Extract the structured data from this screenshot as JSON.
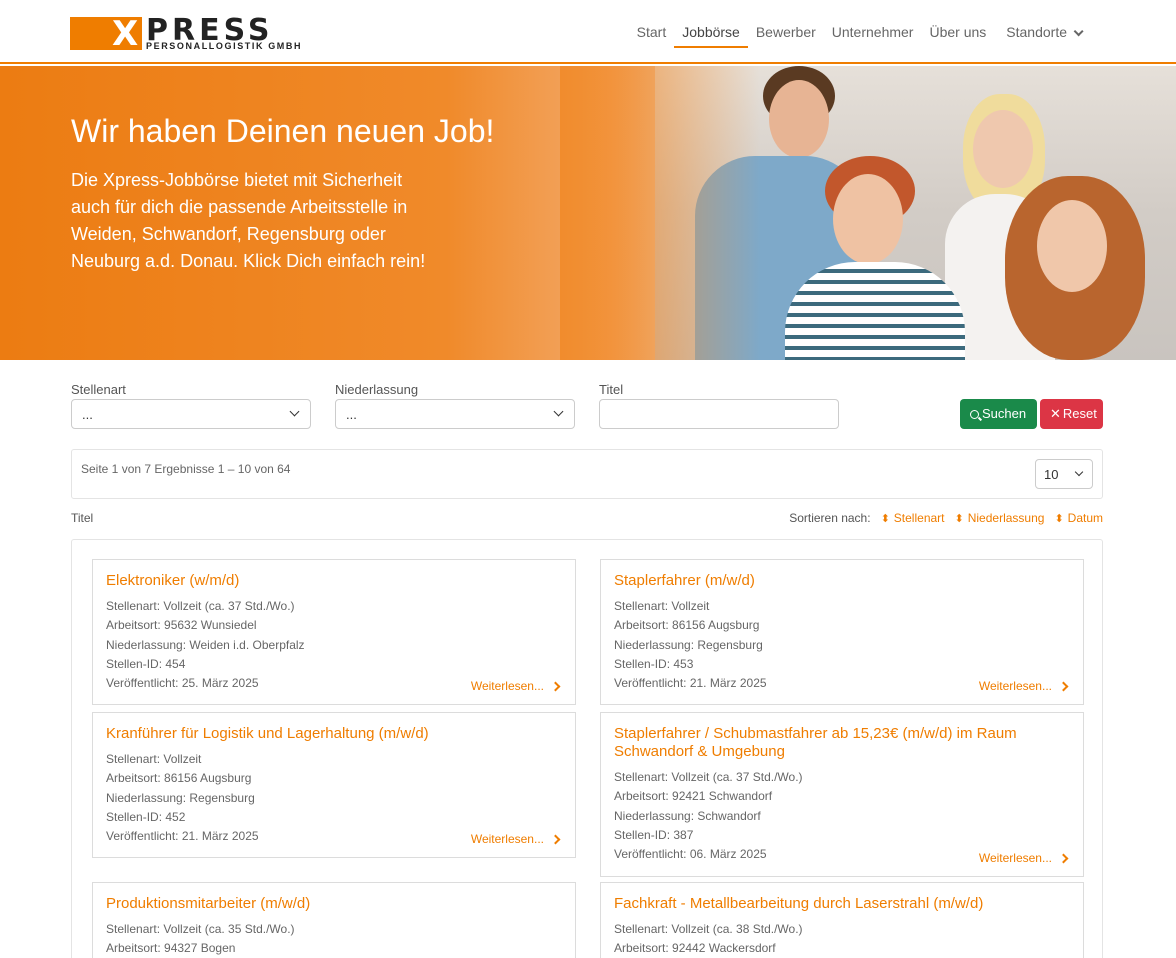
{
  "brand": {
    "logo_mark": "X",
    "logo_word": "PRESS",
    "logo_sub": "PERSONALLOGISTIK GMBH",
    "accent": "#ef7d00"
  },
  "nav": {
    "items": [
      "Start",
      "Jobbörse",
      "Bewerber",
      "Unternehmer",
      "Über uns",
      "Standorte"
    ],
    "active": "Jobbörse"
  },
  "hero": {
    "title": "Wir haben Deinen neuen Job!",
    "text": "Die Xpress-Jobbörse bietet mit Sicherheit auch für dich die passende Arbeitsstelle in Weiden, Schwandorf, Regensburg oder Neuburg a.d. Donau. Klick Dich einfach rein!"
  },
  "filters": {
    "stellenart": {
      "label": "Stellenart",
      "value": "..."
    },
    "niederlassung": {
      "label": "Niederlassung",
      "value": "..."
    },
    "titel": {
      "label": "Titel",
      "value": ""
    },
    "search_label": "Suchen",
    "reset_label": "Reset",
    "search_icon": "search-icon",
    "reset_icon": "close-icon"
  },
  "results": {
    "summary": "Seite 1 von 7 Ergebnisse 1 – 10 von 64",
    "per_page": "10"
  },
  "sort": {
    "title_label": "Titel",
    "label": "Sortieren nach:",
    "options": [
      "Stellenart",
      "Niederlassung",
      "Datum"
    ]
  },
  "jobs": [
    {
      "title": "Elektroniker (w/m/d)",
      "lines": [
        "Stellenart: Vollzeit (ca. 37 Std./Wo.)",
        "Arbeitsort: 95632 Wunsiedel",
        "Niederlassung: Weiden i.d. Oberpfalz",
        "Stellen-ID: 454",
        "Veröffentlicht: 25. März 2025"
      ],
      "more": "Weiterlesen..."
    },
    {
      "title": "Staplerfahrer (m/w/d)",
      "lines": [
        "Stellenart: Vollzeit",
        "Arbeitsort: 86156 Augsburg",
        "Niederlassung: Regensburg",
        "Stellen-ID: 453",
        "Veröffentlicht: 21. März 2025"
      ],
      "more": "Weiterlesen..."
    },
    {
      "title": "Kranführer für Logistik und Lagerhaltung (m/w/d)",
      "lines": [
        "Stellenart: Vollzeit",
        "Arbeitsort: 86156 Augsburg",
        "Niederlassung: Regensburg",
        "Stellen-ID: 452",
        "Veröffentlicht: 21. März 2025"
      ],
      "more": "Weiterlesen..."
    },
    {
      "title": "Staplerfahrer / Schubmastfahrer ab 15,23€ (m/w/d) im Raum Schwandorf & Umgebung",
      "lines": [
        "Stellenart: Vollzeit (ca. 37 Std./Wo.)",
        "Arbeitsort: 92421 Schwandorf",
        "Niederlassung: Schwandorf",
        "Stellen-ID: 387",
        "Veröffentlicht: 06. März 2025"
      ],
      "more": "Weiterlesen..."
    },
    {
      "title": "Produktionsmitarbeiter (m/w/d)",
      "lines": [
        "Stellenart: Vollzeit (ca. 35 Std./Wo.)",
        "Arbeitsort: 94327 Bogen"
      ],
      "more": ""
    },
    {
      "title": "Fachkraft - Metallbearbeitung durch Laserstrahl (m/w/d)",
      "lines": [
        "Stellenart: Vollzeit (ca. 38 Std./Wo.)",
        "Arbeitsort: 92442 Wackersdorf"
      ],
      "more": ""
    }
  ]
}
